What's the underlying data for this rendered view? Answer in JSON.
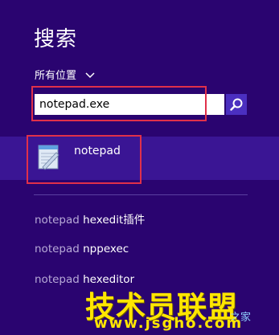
{
  "panel": {
    "title": "搜索",
    "scope_label": "所有位置"
  },
  "search": {
    "value": "notepad.exe",
    "button_icon": "magnifier-icon"
  },
  "app_result": {
    "label": "notepad",
    "icon": "notepad-icon"
  },
  "suggestions": [
    {
      "query": "notepad",
      "rest": " hexedit插件"
    },
    {
      "query": "notepad",
      "rest": " nppexec"
    },
    {
      "query": "notepad",
      "rest": " hexeditor"
    }
  ],
  "watermark": {
    "main": "技术员联盟",
    "side": "之家",
    "url": "www.jsgho.com"
  },
  "colors": {
    "background": "#2a0470",
    "highlight_border": "#e0304a",
    "search_button": "#4b2fc0",
    "watermark": "#ffe600"
  }
}
